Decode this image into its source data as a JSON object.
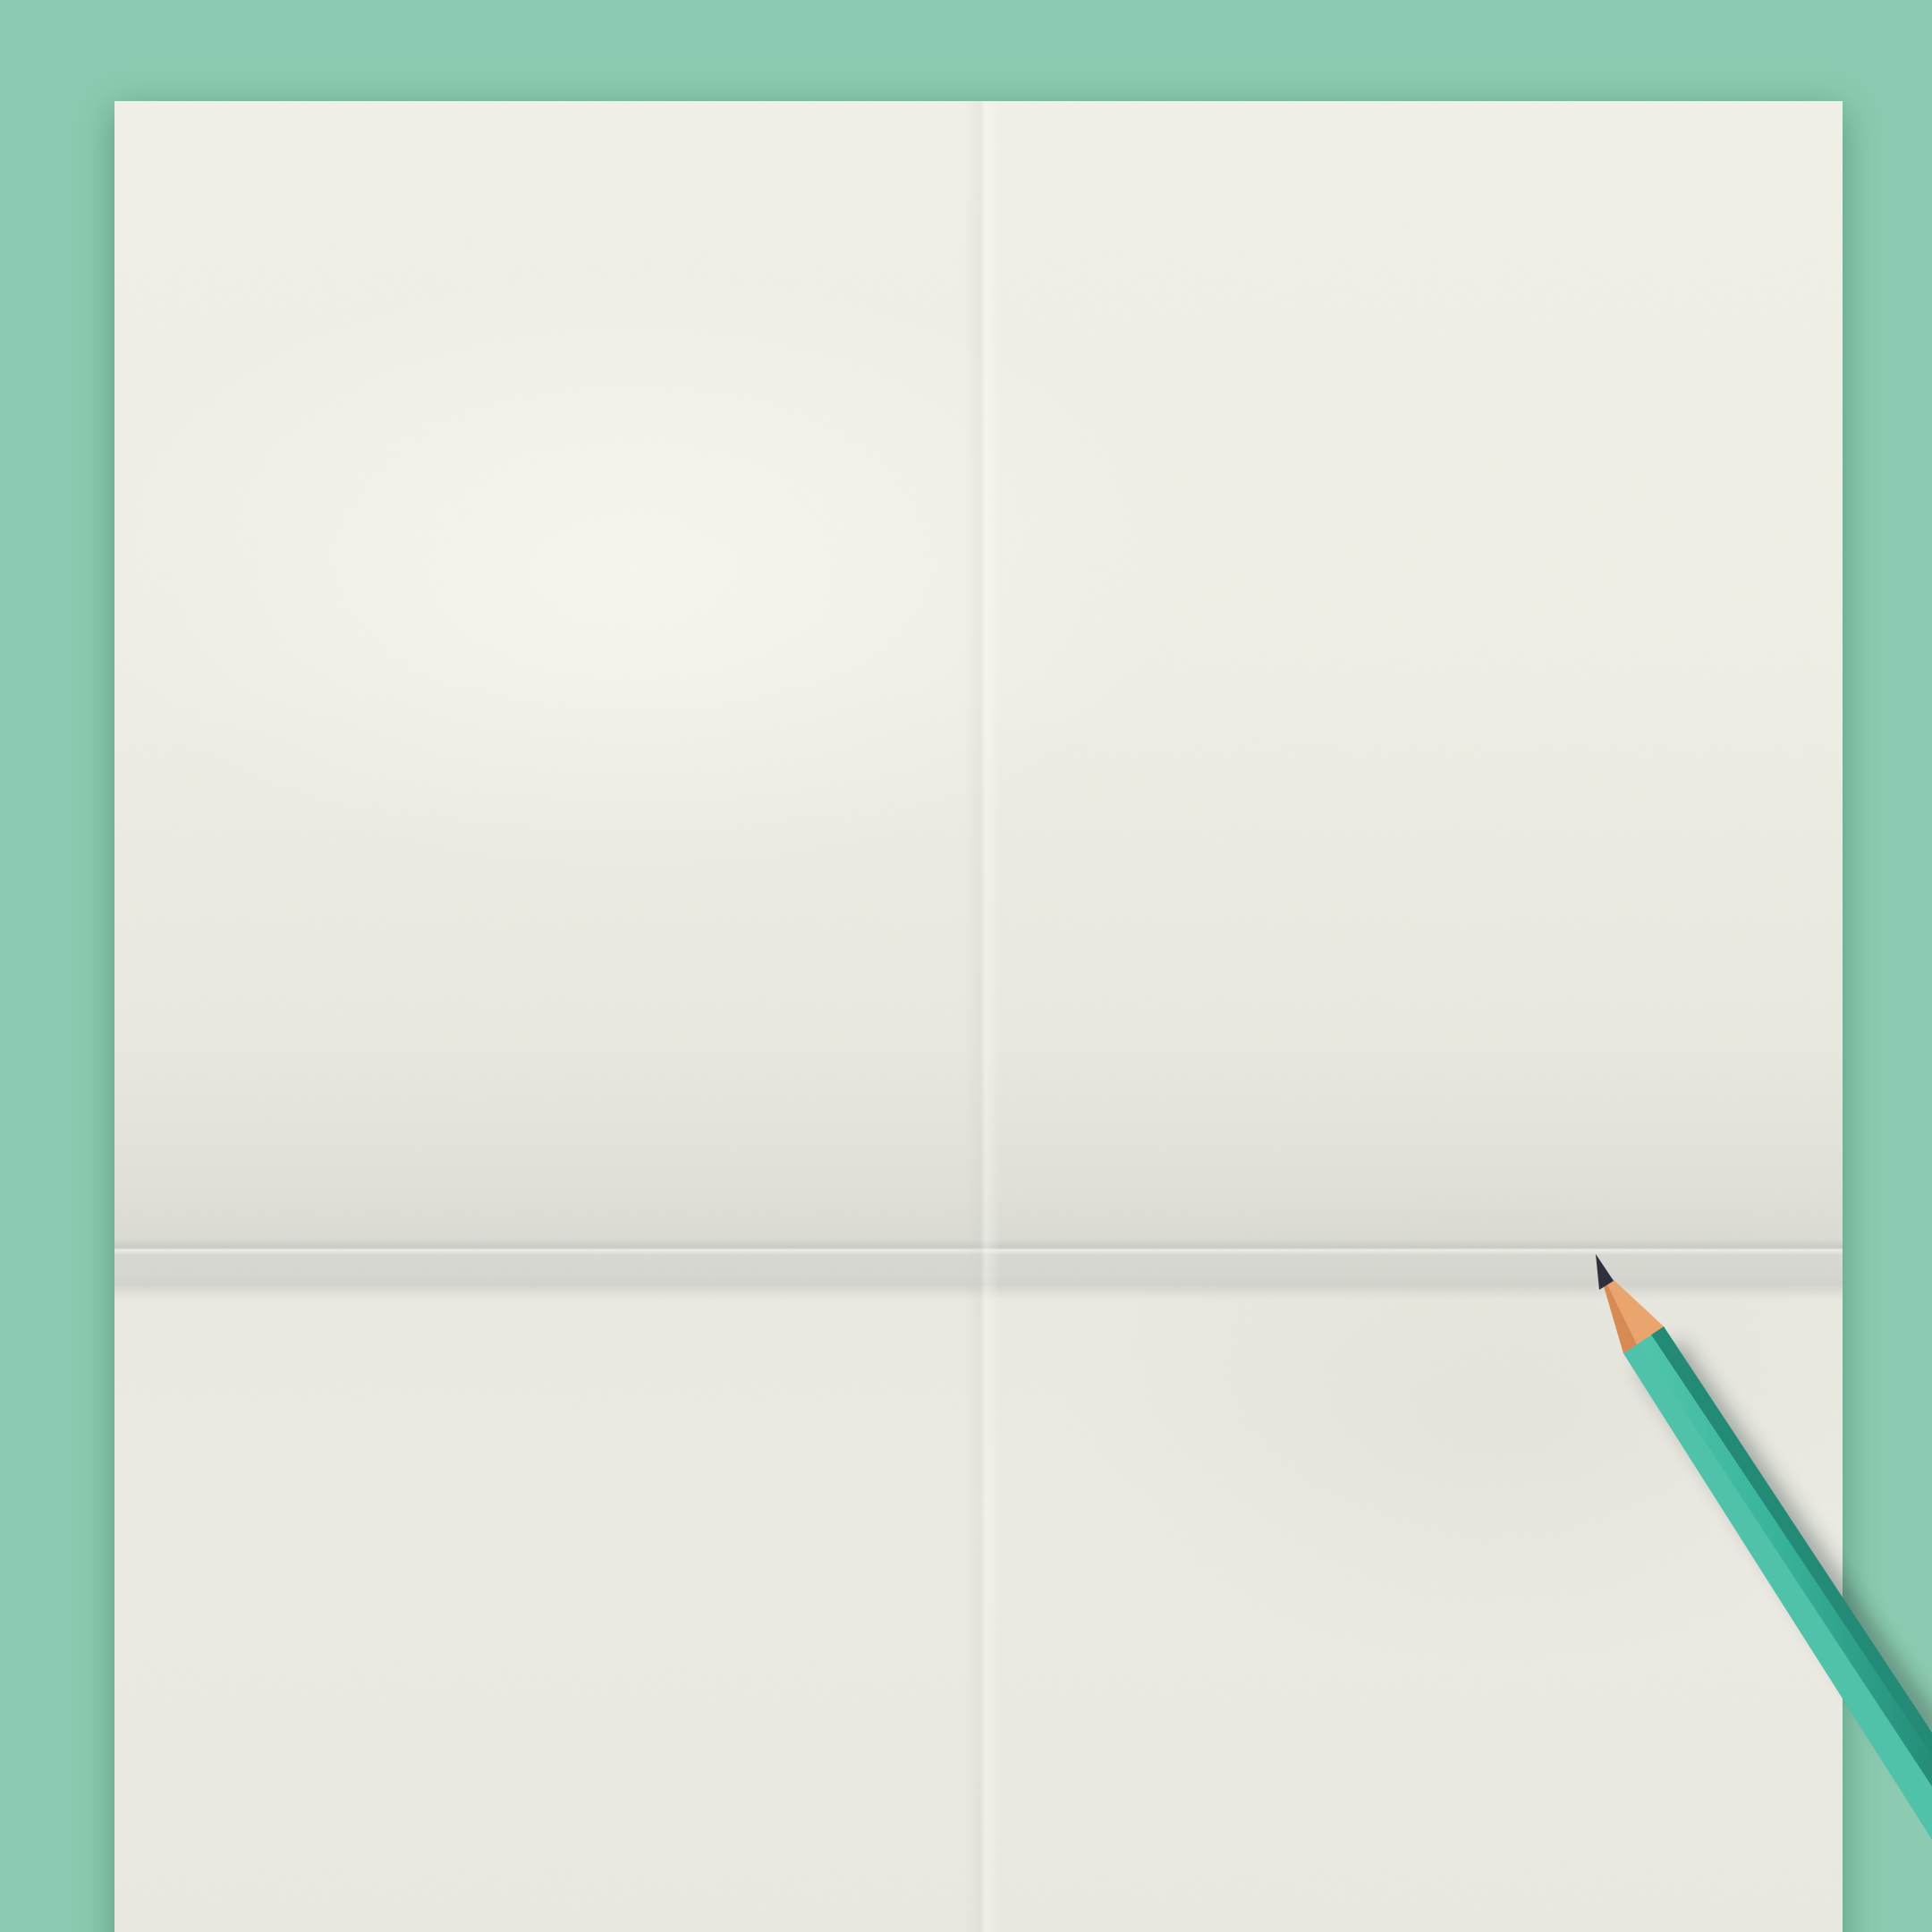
{
  "scene": {
    "background_color": "#8ccbb1",
    "paper_color": "#f3f2e9",
    "pencil_body_color": "#3ab59d",
    "pencil_dark_color": "#238a76",
    "pencil_wood_color": "#e9a36c",
    "pencil_lead_color": "#2f2f3f"
  },
  "icons": {
    "pencil": "pencil-icon"
  }
}
